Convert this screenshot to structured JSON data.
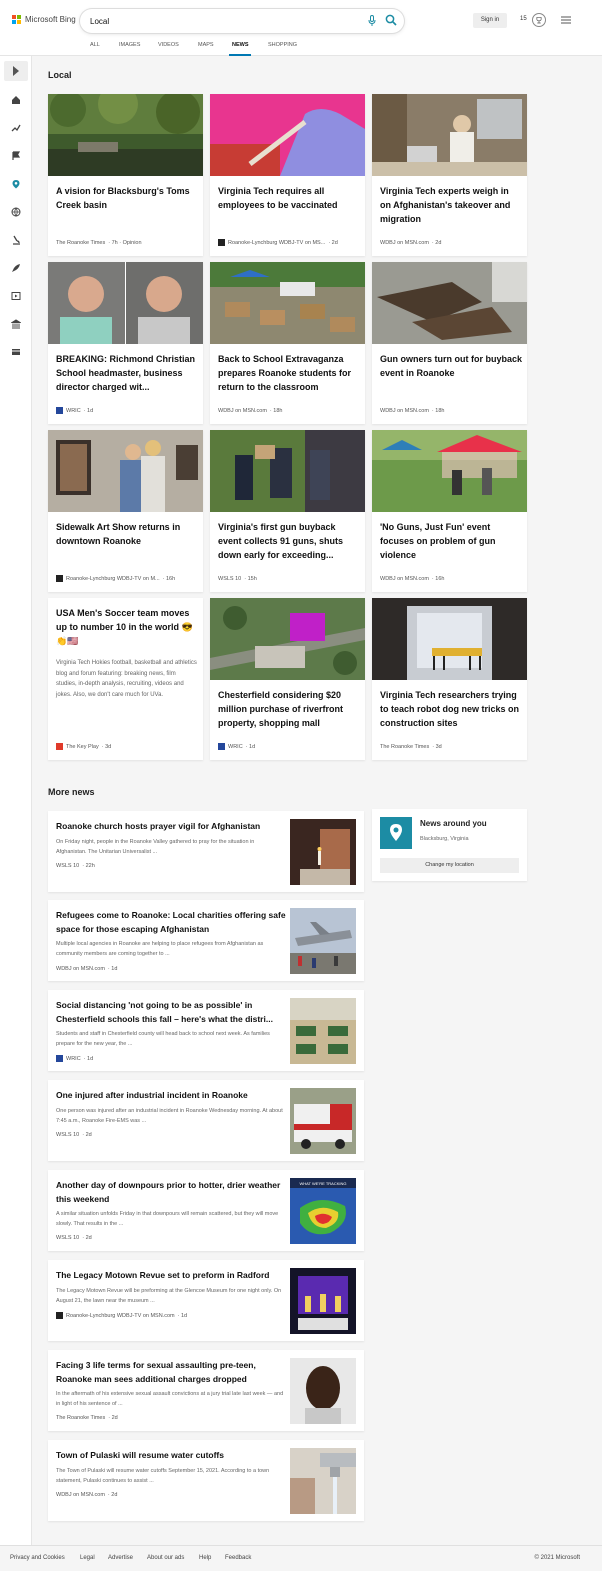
{
  "header": {
    "logo_text": "Microsoft Bing",
    "search_value": "Local",
    "sign_in": "Sign in",
    "rewards_count": "15",
    "tabs": [
      "ALL",
      "IMAGES",
      "VIDEOS",
      "MAPS",
      "NEWS",
      "SHOPPING"
    ],
    "active_tab": "NEWS"
  },
  "local": {
    "title": "Local",
    "cards": [
      {
        "title": "A vision for Blacksburg's Toms Creek basin",
        "source": "The Roanoke Times",
        "meta": "· 7h · Opinion"
      },
      {
        "title": "Virginia Tech requires all employees to be vaccinated",
        "source": "Roanoke-Lynchburg WDBJ-TV on MS...",
        "meta": "· 2d"
      },
      {
        "title": "Virginia Tech experts weigh in on Afghanistan's takeover and migration",
        "source": "WDBJ on MSN.com",
        "meta": "· 2d"
      },
      {
        "title": "BREAKING: Richmond Christian School headmaster, business director charged wit...",
        "source": "WRIC",
        "meta": "· 1d"
      },
      {
        "title": "Back to School Extravaganza prepares Roanoke students for return to the classroom",
        "source": "WDBJ on MSN.com",
        "meta": "· 18h"
      },
      {
        "title": "Gun owners turn out for buyback event in Roanoke",
        "source": "WDBJ on MSN.com",
        "meta": "· 18h"
      },
      {
        "title": "Sidewalk Art Show returns in downtown Roanoke",
        "source": "Roanoke-Lynchburg WDBJ-TV on M...",
        "meta": "· 16h"
      },
      {
        "title": "Virginia's first gun buyback event collects 91 guns, shuts down early for exceeding...",
        "source": "WSLS 10",
        "meta": "· 15h"
      },
      {
        "title": "'No Guns, Just Fun' event focuses on problem of gun violence",
        "source": "WDBJ on MSN.com",
        "meta": "· 16h"
      },
      {
        "title": "USA Men's Soccer team moves up to number 10 in the world 😎👏🇺🇸",
        "text": "Virginia Tech Hokies football, basketball and athletics blog and forum featuring: breaking news, film studies, in-depth analysis, recruiting, videos and jokes. Also, we don't care much for UVa.",
        "source": "The Key Play",
        "meta": "· 3d"
      },
      {
        "title": "Chesterfield considering $20 million purchase of riverfront property, shopping mall",
        "source": "WRIC",
        "meta": "· 1d"
      },
      {
        "title": "Virginia Tech researchers trying to teach robot dog new tricks on construction sites",
        "source": "The Roanoke Times",
        "meta": "· 3d"
      }
    ]
  },
  "more_news": {
    "title": "More news",
    "items": [
      {
        "title": "Roanoke church hosts prayer vigil for Afghanistan",
        "snippet": "On Friday night, people in the Roanoke Valley gathered to pray for the situation in Afghanistan. The Unitarian Universalist ...",
        "source": "WSLS 10",
        "meta": "· 22h"
      },
      {
        "title": "Refugees come to Roanoke: Local charities offering safe space for those escaping Afghanistan",
        "snippet": "Multiple local agencies in Roanoke are helping to place refugees from Afghanistan as community members are coming together to ...",
        "source": "WDBJ on MSN.com",
        "meta": "· 1d"
      },
      {
        "title": "Social distancing 'not going to be as possible' in Chesterfield schools this fall – here's what the distri...",
        "snippet": "Students and staff in Chesterfield county will head back to school next week. As families prepare for the new year, the ...",
        "source": "WRIC",
        "meta": "· 1d"
      },
      {
        "title": "One injured after industrial incident in Roanoke",
        "snippet": "One person was injured after an industrial incident in Roanoke Wednesday morning. At about 7:45 a.m., Roanoke Fire-EMS was ...",
        "source": "WSLS 10",
        "meta": "· 2d"
      },
      {
        "title": "Another day of downpours prior to hotter, drier weather this weekend",
        "snippet": "A similar situation unfolds Friday in that downpours will remain scattered, but they will move slowly. That results in the ...",
        "source": "WSLS 10",
        "meta": "· 2d",
        "img_text": "WHAT WE'RE TRACKING"
      },
      {
        "title": "The Legacy Motown Revue set to preform in Radford",
        "snippet": "The Legacy Motown Revue will be preforming at the Glencoe Museum for one night only. On August 21, the lawn near the museum ...",
        "source": "Roanoke-Lynchburg WDBJ-TV on MSN.com",
        "meta": "· 1d"
      },
      {
        "title": "Facing 3 life terms for sexual assaulting pre-teen, Roanoke man sees additional charges dropped",
        "snippet": "In the aftermath of his extensive sexual assault convictions at a jury trial late last week — and in light of his sentence of ...",
        "source": "The Roanoke Times",
        "meta": "· 2d"
      },
      {
        "title": "Town of Pulaski will resume water cutoffs",
        "snippet": "The Town of Pulaski will resume water cutoffs September 15, 2021. According to a town statement, Pulaski continues to assist ...",
        "source": "WDBJ on MSN.com",
        "meta": "· 2d"
      }
    ]
  },
  "around": {
    "title": "News around you",
    "location": "Blacksburg, Virginia",
    "button": "Change my location"
  },
  "footer": {
    "links": [
      "Privacy and Cookies",
      "Legal",
      "Advertise",
      "About our ads",
      "Help",
      "Feedback"
    ],
    "copyright": "© 2021 Microsoft"
  }
}
